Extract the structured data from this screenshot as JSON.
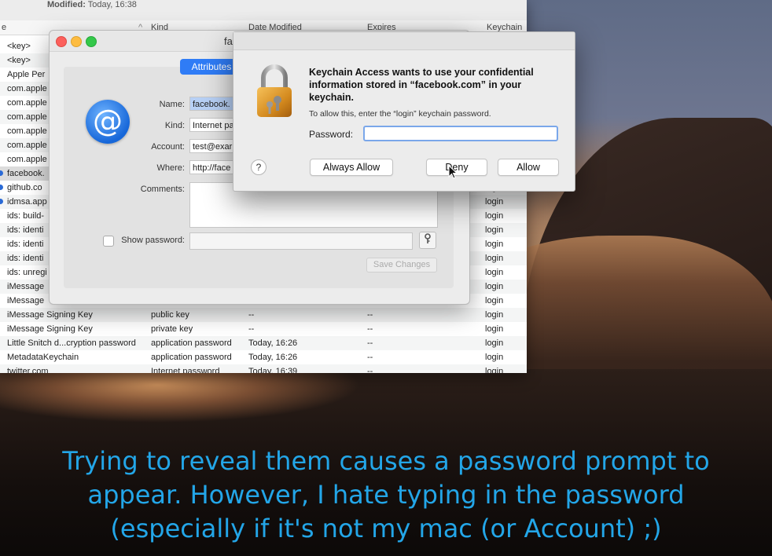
{
  "keychain": {
    "modified_label": "Modified:",
    "modified_value": "Today, 16:38",
    "columns": [
      "e",
      "Kind",
      "Date Modified",
      "Expires",
      "Keychain"
    ],
    "rows": [
      {
        "name": "<key>",
        "kind": "",
        "date": "",
        "expires": "",
        "keychain": ""
      },
      {
        "name": "<key>",
        "kind": "",
        "date": "",
        "expires": "",
        "keychain": ""
      },
      {
        "name": "Apple Per",
        "kind": "",
        "date": "",
        "expires": "",
        "keychain": ""
      },
      {
        "name": "com.apple",
        "kind": "",
        "date": "",
        "expires": "",
        "keychain": ""
      },
      {
        "name": "com.apple",
        "kind": "",
        "date": "",
        "expires": "",
        "keychain": ""
      },
      {
        "name": "com.apple",
        "kind": "",
        "date": "",
        "expires": "",
        "keychain": ""
      },
      {
        "name": "com.apple",
        "kind": "",
        "date": "",
        "expires": "",
        "keychain": ""
      },
      {
        "name": "com.apple",
        "kind": "",
        "date": "",
        "expires": "",
        "keychain": ""
      },
      {
        "name": "com.apple",
        "kind": "",
        "date": "",
        "expires": "",
        "keychain": ""
      },
      {
        "name": "facebook.",
        "kind": "",
        "date": "",
        "expires": "",
        "keychain": ""
      },
      {
        "name": "github.co",
        "kind": "",
        "date": "",
        "expires": "",
        "keychain": "login"
      },
      {
        "name": "idmsa.app",
        "kind": "",
        "date": "",
        "expires": "",
        "keychain": "login"
      },
      {
        "name": "ids: build-",
        "kind": "",
        "date": "",
        "expires": "",
        "keychain": "login"
      },
      {
        "name": "ids: identi",
        "kind": "",
        "date": "",
        "expires": "",
        "keychain": "login"
      },
      {
        "name": "ids: identi",
        "kind": "",
        "date": "",
        "expires": "",
        "keychain": "login"
      },
      {
        "name": "ids: identi",
        "kind": "",
        "date": "",
        "expires": "",
        "keychain": "login"
      },
      {
        "name": "ids: unregi",
        "kind": "",
        "date": "",
        "expires": "",
        "keychain": "login"
      },
      {
        "name": "iMessage",
        "kind": "",
        "date": "",
        "expires": "",
        "keychain": "login"
      },
      {
        "name": "iMessage",
        "kind": "",
        "date": "",
        "expires": "",
        "keychain": "login"
      },
      {
        "name": "iMessage Signing Key",
        "kind": "public key",
        "date": "--",
        "expires": "--",
        "keychain": "login"
      },
      {
        "name": "iMessage Signing Key",
        "kind": "private key",
        "date": "--",
        "expires": "--",
        "keychain": "login"
      },
      {
        "name": "Little Snitch d...cryption password",
        "kind": "application password",
        "date": "Today, 16:26",
        "expires": "--",
        "keychain": "login"
      },
      {
        "name": "MetadataKeychain",
        "kind": "application password",
        "date": "Today, 16:26",
        "expires": "--",
        "keychain": "login"
      },
      {
        "name": "twitter.com",
        "kind": "Internet password",
        "date": "Today, 16:39",
        "expires": "--",
        "keychain": "login"
      }
    ]
  },
  "attributes_window": {
    "title": "fa",
    "tab_label": "Attributes",
    "icon_glyph": "@",
    "name_label": "Name:",
    "name_value": "facebook.",
    "kind_label": "Kind:",
    "kind_value": "Internet pa",
    "account_label": "Account:",
    "account_value": "test@exar",
    "where_label": "Where:",
    "where_value": "http://face",
    "comments_label": "Comments:",
    "show_password_label": "Show password:",
    "save_changes_label": "Save Changes"
  },
  "dialog": {
    "title_line": "Keychain Access wants to use your confidential information stored in “facebook.com” in your keychain.",
    "subtitle": "To allow this, enter the “login” keychain password.",
    "password_label": "Password:",
    "password_value": "",
    "help_label": "?",
    "always_allow_label": "Always Allow",
    "deny_label": "Deny",
    "allow_label": "Allow"
  },
  "caption": {
    "line1": "Trying to reveal them causes a password prompt to",
    "line2": "appear. However, I hate typing in the password",
    "line3": "(especially if it's not my mac (or Account) ;)"
  },
  "colors": {
    "accent": "#2f7cf6",
    "caption": "#23a6e8"
  }
}
